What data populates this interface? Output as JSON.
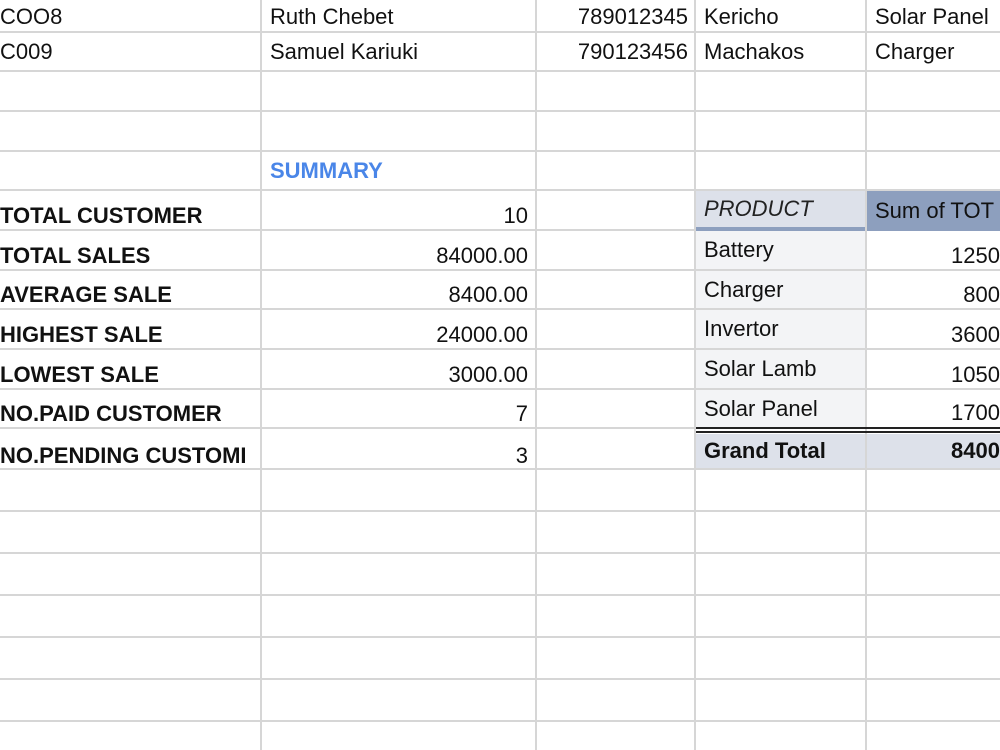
{
  "rows_top": [
    {
      "id": "COO8",
      "name": "Ruth Chebet",
      "phone": "789012345",
      "location": "Kericho",
      "product": "Solar Panel"
    },
    {
      "id": "C009",
      "name": "Samuel Kariuki",
      "phone": "790123456",
      "location": "Machakos",
      "product": "Charger"
    }
  ],
  "summary": {
    "title": "SUMMARY",
    "rows": [
      {
        "label": "TOTAL CUSTOMER",
        "value": "10"
      },
      {
        "label": "TOTAL SALES",
        "value": "84000.00"
      },
      {
        "label": "AVERAGE SALE",
        "value": "8400.00"
      },
      {
        "label": "HIGHEST SALE",
        "value": "24000.00"
      },
      {
        "label": "LOWEST SALE",
        "value": "3000.00"
      },
      {
        "label": "NO.PAID CUSTOMER",
        "value": "7"
      },
      {
        "label": "NO.PENDING CUSTOMI",
        "value": "3"
      }
    ]
  },
  "pivot": {
    "header_product": "PRODUCT",
    "header_sum": "Sum of TOT",
    "rows": [
      {
        "product": "Battery",
        "sum": "1250"
      },
      {
        "product": "Charger",
        "sum": "800"
      },
      {
        "product": "Invertor",
        "sum": "3600"
      },
      {
        "product": "Solar Lamb",
        "sum": "1050"
      },
      {
        "product": "Solar Panel",
        "sum": "1700"
      }
    ],
    "grand_total_label": "Grand Total",
    "grand_total_value": "8400"
  },
  "colors": {
    "summary_title": "#4a86e8",
    "pivot_header_dark": "#8d9fbe",
    "pivot_header_light": "#dde1ea",
    "gridline": "#d6d6d6"
  }
}
